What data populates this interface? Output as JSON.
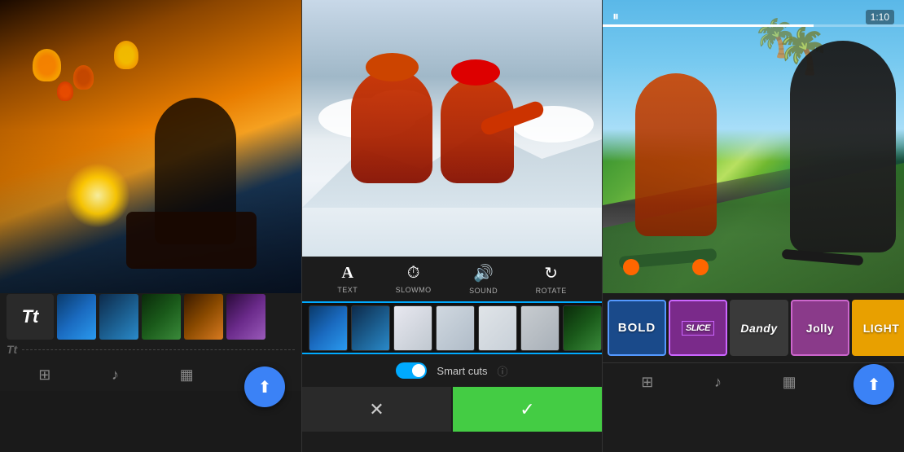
{
  "panels": [
    {
      "id": "panel-1",
      "type": "text-editor",
      "fab_icon": "⬆",
      "timeline_thumbs": [
        "blue",
        "ocean",
        "green",
        "orange",
        "purple"
      ],
      "bottom_icons": [
        "➕",
        "♪",
        "▦",
        "⊞"
      ],
      "text_label": "Tt"
    },
    {
      "id": "panel-2",
      "type": "clip-editor",
      "edit_tools": [
        {
          "icon": "A",
          "label": "TEXT"
        },
        {
          "icon": "⏱",
          "label": "SLOWMO"
        },
        {
          "icon": "🔊",
          "label": "SOUND"
        },
        {
          "icon": "↻",
          "label": "ROTATE"
        }
      ],
      "timeline_thumbs": [
        "blue",
        "ocean",
        "green",
        "orange",
        "purple",
        "teal"
      ],
      "smart_cuts_label": "Smart cuts",
      "cancel_icon": "✕",
      "confirm_icon": "✓"
    },
    {
      "id": "panel-3",
      "type": "filter-selector",
      "time_display": "1:10",
      "play_icon": "⏸",
      "filters": [
        {
          "name": "BOLD",
          "style": "bold"
        },
        {
          "name": "SLICE",
          "style": "slice"
        },
        {
          "name": "Dandy",
          "style": "dandy"
        },
        {
          "name": "Jolly",
          "style": "jolly"
        },
        {
          "name": "LIGHT",
          "style": "light"
        }
      ],
      "fab_icon": "⬆",
      "bottom_icons": [
        "➕",
        "♪",
        "▦",
        "⊞"
      ]
    }
  ]
}
